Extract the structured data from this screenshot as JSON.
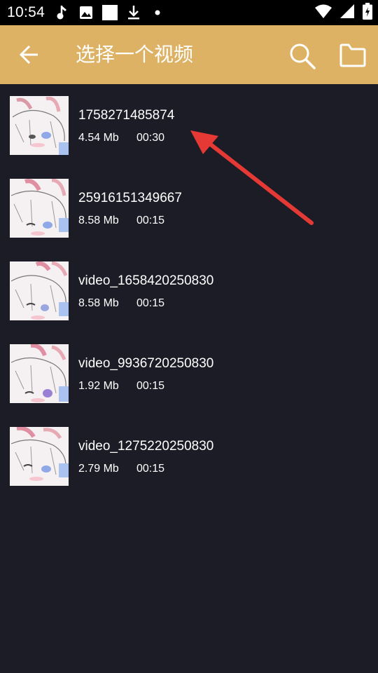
{
  "status_bar": {
    "time": "10:54",
    "left_icons": [
      "music-note-icon",
      "image-icon",
      "square-icon",
      "download-icon",
      "dot-icon"
    ],
    "right_icons": [
      "wifi-icon",
      "signal-icon",
      "battery-icon"
    ]
  },
  "toolbar": {
    "title": "选择一个视频",
    "background_color": "#deb264",
    "icons": [
      "back-arrow-icon",
      "search-icon",
      "folder-icon"
    ]
  },
  "videos": [
    {
      "name": "1758271485874",
      "size": "4.54 Mb",
      "duration": "00:30",
      "thumbnail": "anime-girl-sketch"
    },
    {
      "name": "25916151349667",
      "size": "8.58 Mb",
      "duration": "00:15",
      "thumbnail": "anime-girl-sketch"
    },
    {
      "name": "video_1658420250830",
      "size": "8.58 Mb",
      "duration": "00:15",
      "thumbnail": "anime-girl-sketch"
    },
    {
      "name": "video_9936720250830",
      "size": "1.92 Mb",
      "duration": "00:15",
      "thumbnail": "anime-girl-sketch"
    },
    {
      "name": "video_1275220250830",
      "size": "2.79 Mb",
      "duration": "00:15",
      "thumbnail": "anime-girl-sketch"
    }
  ],
  "annotation": {
    "type": "red-arrow",
    "color": "#e53935",
    "points_to": "videos.0"
  },
  "colors": {
    "background": "#1c1c26",
    "status_bar": "#000000",
    "text": "#ffffff"
  }
}
